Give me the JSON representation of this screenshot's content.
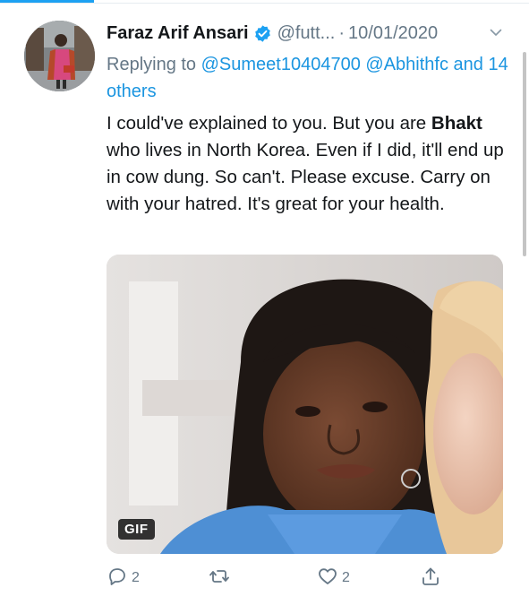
{
  "tweet": {
    "author": {
      "name": "Faraz Arif Ansari",
      "handle": "@futt...",
      "verified_icon": "verified-badge-icon"
    },
    "date": "10/01/2020",
    "separator": "·",
    "reply": {
      "prefix": "Replying to",
      "mention1": "@Sumeet10404700",
      "mention2": "@Abhithfc",
      "others": "and 14 others"
    },
    "text": {
      "part1": "I could've explained to you. But you are",
      "bold": "Bhakt",
      "part2": "who lives in North Korea. Even if I did, it'll end up in cow dung. So can't. Please excuse. Carry on with your hatred. It's great for your health."
    },
    "media": {
      "badge": "GIF"
    },
    "actions": {
      "reply_count": "2",
      "retweet_count": "",
      "like_count": "2"
    }
  },
  "colors": {
    "accent": "#1da1f2",
    "link": "#1b95e0",
    "muted": "#657786",
    "text": "#14171a"
  }
}
